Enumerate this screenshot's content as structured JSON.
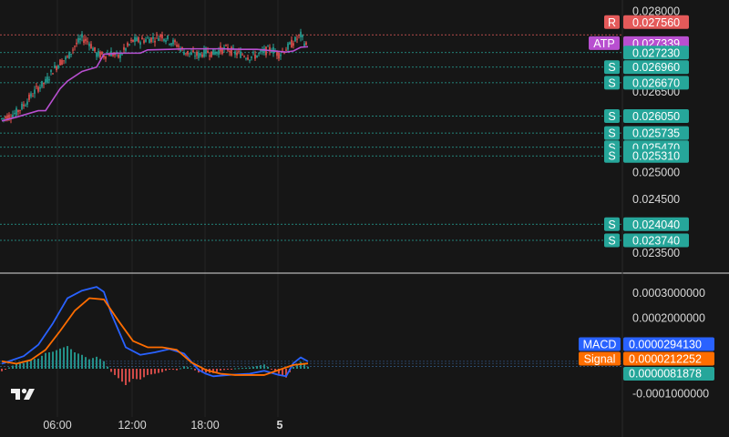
{
  "chart_data": [
    {
      "type": "candlestick",
      "ylim": [
        0.0233,
        0.0281
      ],
      "y_ticks": [
        "0.028000",
        "0.026500",
        "0.025000",
        "0.024500",
        "0.023500"
      ],
      "x_ticks": [
        "06:00",
        "12:00",
        "18:00",
        "5"
      ],
      "series": [
        {
          "name": "ATP",
          "color": "#b84fd0",
          "x": [
            0,
            2,
            5,
            6,
            8,
            9,
            11,
            13,
            14,
            16,
            17,
            19,
            20,
            23,
            25,
            30,
            33,
            35,
            39,
            40,
            41,
            42
          ],
          "y": [
            0.02596,
            0.02603,
            0.02615,
            0.02615,
            0.02656,
            0.0267,
            0.02688,
            0.02696,
            0.0272,
            0.02722,
            0.02722,
            0.02722,
            0.02728,
            0.02729,
            0.0273,
            0.0273,
            0.02729,
            0.02729,
            0.02724,
            0.02726,
            0.02733,
            0.02734
          ]
        }
      ],
      "levels": [
        {
          "label": "R",
          "value": "0.027560",
          "y": 0.02756,
          "color": "#e45a5a"
        },
        {
          "label": "",
          "value": "0.027230",
          "y": 0.02723,
          "color": "#26a69a"
        },
        {
          "label": "S",
          "value": "0.026960",
          "y": 0.02696,
          "color": "#26a69a"
        },
        {
          "label": "S",
          "value": "0.026670",
          "y": 0.02667,
          "color": "#26a69a"
        },
        {
          "label": "S",
          "value": "0.026050",
          "y": 0.02605,
          "color": "#26a69a"
        },
        {
          "label": "S",
          "value": "0.025735",
          "y": 0.025735,
          "color": "#26a69a"
        },
        {
          "label": "S",
          "value": "0.025470",
          "y": 0.02547,
          "color": "#26a69a"
        },
        {
          "label": "S",
          "value": "0.025310",
          "y": 0.02531,
          "color": "#26a69a"
        },
        {
          "label": "S",
          "value": "0.024040",
          "y": 0.02404,
          "color": "#26a69a"
        },
        {
          "label": "S",
          "value": "0.023740",
          "y": 0.02374,
          "color": "#26a69a"
        }
      ],
      "atp_tag": {
        "label": "ATP",
        "value": "0.027339",
        "color": "#b84fd0"
      },
      "colors": {
        "up": "#26a69a",
        "down": "#ef5350",
        "background": "#161616",
        "text": "#d8d8d8"
      }
    },
    {
      "type": "line",
      "ylim": [
        -0.00012,
        0.00033
      ],
      "y_ticks": [
        "0.0003000000",
        "0.0002000000",
        "-0.0001000000"
      ],
      "series": [
        {
          "name": "MACD",
          "value": "0.0000294130",
          "color": "#2962ff",
          "x": [
            0,
            3,
            5,
            7,
            9,
            11,
            13,
            14,
            15,
            17,
            19,
            21,
            23,
            25,
            27,
            28,
            29,
            31,
            34,
            36,
            38,
            39,
            40,
            41,
            42
          ],
          "y": [
            2e-05,
            5e-05,
            9.5e-05,
            0.00018,
            0.00028,
            0.00031,
            0.000325,
            0.000305,
            0.00022,
            8.5e-05,
            5.5e-05,
            6.5e-05,
            7.8e-05,
            6e-05,
            -5e-06,
            -2e-05,
            -3e-05,
            -2.5e-05,
            -2e-05,
            -8e-06,
            -2.5e-05,
            -3e-05,
            2.2e-05,
            4.5e-05,
            2.9e-05
          ]
        },
        {
          "name": "Signal",
          "value": "0.0000212252",
          "color": "#ff6d00",
          "x": [
            0,
            2,
            4,
            6,
            8,
            10,
            12,
            14,
            16,
            18,
            20,
            22,
            24,
            26,
            28,
            30,
            32,
            34,
            36,
            38,
            40,
            42
          ],
          "y": [
            3e-05,
            2e-05,
            3.5e-05,
            7.5e-05,
            0.00015,
            0.00023,
            0.00028,
            0.000275,
            0.00019,
            0.00011,
            8.5e-05,
            8.5e-05,
            7.5e-05,
            2.5e-05,
            -5e-06,
            -2e-05,
            -2.5e-05,
            -2.5e-05,
            -2.5e-05,
            -5e-06,
            1.5e-05,
            2.1e-05
          ]
        }
      ],
      "histogram_value": "0.0000081878",
      "colors": {
        "hist_up": "#26a69a",
        "hist_down": "#ef5350"
      }
    }
  ]
}
